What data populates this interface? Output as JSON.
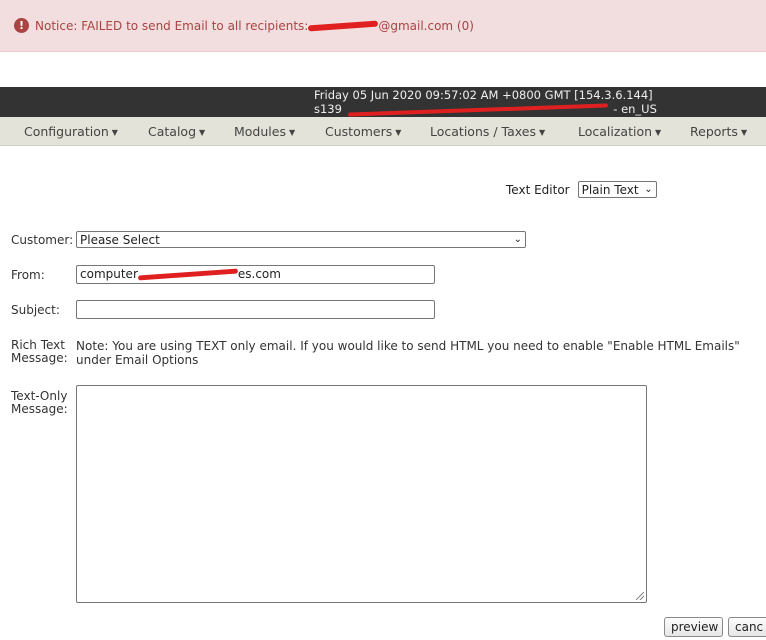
{
  "notice": {
    "icon": "exclamation-circle-icon",
    "prefix": "Notice: FAILED to send Email to all recipients: ",
    "suffix": "@gmail.com (0)",
    "color": "#a94442",
    "background": "#f2dede"
  },
  "header": {
    "datetime": "Friday 05 Jun 2020 09:57:02 AM +0800 GMT [154.3.6.144]",
    "host_prefix": "s139",
    "host_suffix": "- en_US"
  },
  "menu": {
    "items": [
      {
        "label": "Configuration"
      },
      {
        "label": "Catalog"
      },
      {
        "label": "Modules"
      },
      {
        "label": "Customers"
      },
      {
        "label": "Locations / Taxes"
      },
      {
        "label": "Localization"
      },
      {
        "label": "Reports"
      }
    ],
    "caret_icon": "caret-down-icon"
  },
  "editor": {
    "label": "Text Editor",
    "selected": "Plain Text"
  },
  "form": {
    "customer_label": "Customer:",
    "customer_selected": "Please Select",
    "from_label": "From:",
    "from_value_prefix": "computer",
    "from_value_suffix": "es.com",
    "subject_label": "Subject:",
    "subject_value": "",
    "rich_label_1": "Rich Text",
    "rich_label_2": "Message:",
    "rich_note": "Note: You are using TEXT only email. If you would like to send HTML you need to enable \"Enable HTML Emails\" under Email Options",
    "text_label_1": "Text-Only",
    "text_label_2": "Message:"
  },
  "buttons": {
    "preview": "preview",
    "cancel": "canc"
  }
}
